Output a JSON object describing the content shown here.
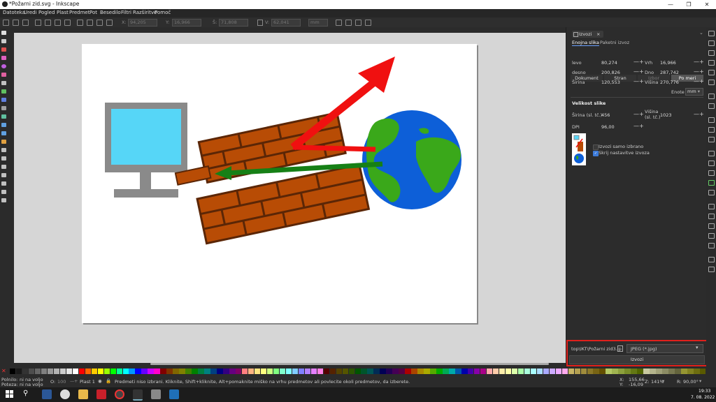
{
  "window": {
    "title": "*Požarni zid.svg - Inkscape",
    "minimize": "—",
    "maximize": "❐",
    "close": "✕"
  },
  "menu": [
    "Datoteka",
    "Uredi",
    "Pogled",
    "Plast",
    "Predmet",
    "Pot",
    "Besedilo",
    "Filtri",
    "Razširitve",
    "Pomoč"
  ],
  "toolbar": {
    "x_label": "X:",
    "x": "94,205",
    "y_label": "Y:",
    "y": "16,966",
    "w_label": "Š:",
    "w": "71,808",
    "h_label": "V:",
    "h": "62,041",
    "unit": "mm"
  },
  "panel": {
    "tab_title": "Izvozi",
    "tab_close": "×",
    "subtabs": [
      "Enojna slika",
      "Paketni izvoz"
    ],
    "area_buttons": [
      "Dokument",
      "Stran",
      "Izbor",
      "Po meri"
    ],
    "fields": {
      "levo_label": "levo",
      "levo": "80,274",
      "vrh_label": "Vrh",
      "vrh": "16,966",
      "desno_label": "desno",
      "desno": "200,826",
      "dno_label": "Dno",
      "dno": "287,742",
      "sirina_label": "Širina",
      "sirina": "120,553",
      "visina_label": "Višina",
      "visina": "270,776"
    },
    "enote_label": "Enote",
    "enote": "mm",
    "image_size_title": "Velikost slike",
    "px_w_label": "Širina (sl. tč.)",
    "px_w": "456",
    "px_h_label": "Višina (sl. tč.)",
    "px_h": "1023",
    "dpi_label": "DPI",
    "dpi": "96,00",
    "export_selected_only": "Izvozi samo izbrano",
    "hide_export_settings": "Skrij nastavitve izvoza",
    "filename": "top\\IKT\\Požarni zid3.jp",
    "format": "JPEG (*.jpg)",
    "export_button": "Izvozi",
    "plus": "+",
    "minus": "—"
  },
  "status": {
    "fill_label": "Polnilo:",
    "fill": "ni na voljo",
    "stroke_label": "Poteza:",
    "stroke": "ni na voljo",
    "o_label": "O:",
    "o": "100",
    "layer": "Plast 1",
    "message": "Predmeti niso izbrani. Kliknite, Shift+kliknite, Alt+pomaknite miško na vrhu predmetov ali povlecite okoli predmetov, da izberete.",
    "x_label": "X:",
    "x": "155,66",
    "y_label": "Y:",
    "y": "-16,09",
    "z_label": "Z:",
    "zoom": "141%",
    "r_label": "R:",
    "rotation": "90,00°"
  },
  "clock": {
    "time": "19:33",
    "date": "7. 08. 2022"
  },
  "palette_colors": [
    "#000000",
    "#1a1a1a",
    "#333333",
    "#4d4d4d",
    "#666666",
    "#808080",
    "#999999",
    "#b3b3b3",
    "#cccccc",
    "#e6e6e6",
    "#ffffff",
    "#ff0000",
    "#ff6600",
    "#ffcc00",
    "#ffff00",
    "#99ff00",
    "#00ff00",
    "#00ff99",
    "#00ffff",
    "#0099ff",
    "#0000ff",
    "#6600ff",
    "#cc00ff",
    "#ff00cc",
    "#800000",
    "#803300",
    "#806600",
    "#808000",
    "#408000",
    "#008000",
    "#008040",
    "#008080",
    "#004080",
    "#000080",
    "#330080",
    "#660080",
    "#800066",
    "#ff8080",
    "#ffb380",
    "#ffe680",
    "#ffff80",
    "#ccff80",
    "#80ff80",
    "#80ffcc",
    "#80ffff",
    "#80ccff",
    "#8080ff",
    "#b380ff",
    "#e680ff",
    "#ff80e6",
    "#550000",
    "#552200",
    "#554400",
    "#555500",
    "#2b5500",
    "#005500",
    "#00552b",
    "#005555",
    "#002b55",
    "#000055",
    "#220055",
    "#440055",
    "#550044",
    "#aa0000",
    "#aa4400",
    "#aa8800",
    "#aaaa00",
    "#55aa00",
    "#00aa00",
    "#00aa55",
    "#00aaaa",
    "#0055aa",
    "#0000aa",
    "#4400aa",
    "#8800aa",
    "#aa0088",
    "#ffaaaa",
    "#ffccaa",
    "#ffeeaa",
    "#ffffaa",
    "#ddffaa",
    "#aaffaa",
    "#aaffdd",
    "#aaffff",
    "#aaddff",
    "#aaaaff",
    "#ccaaff",
    "#eeaaff",
    "#ffaaee",
    "#c8b464",
    "#b4a050",
    "#a08c3c",
    "#8c7828",
    "#786414",
    "#645000",
    "#b4c864",
    "#a0b450",
    "#8ca03c",
    "#788c28",
    "#647814",
    "#506400",
    "#c8c8a0",
    "#b4b48c",
    "#a0a078",
    "#8c8c64",
    "#787850",
    "#64643c",
    "#969632",
    "#828220",
    "#6e6e10",
    "#5a5a00"
  ]
}
